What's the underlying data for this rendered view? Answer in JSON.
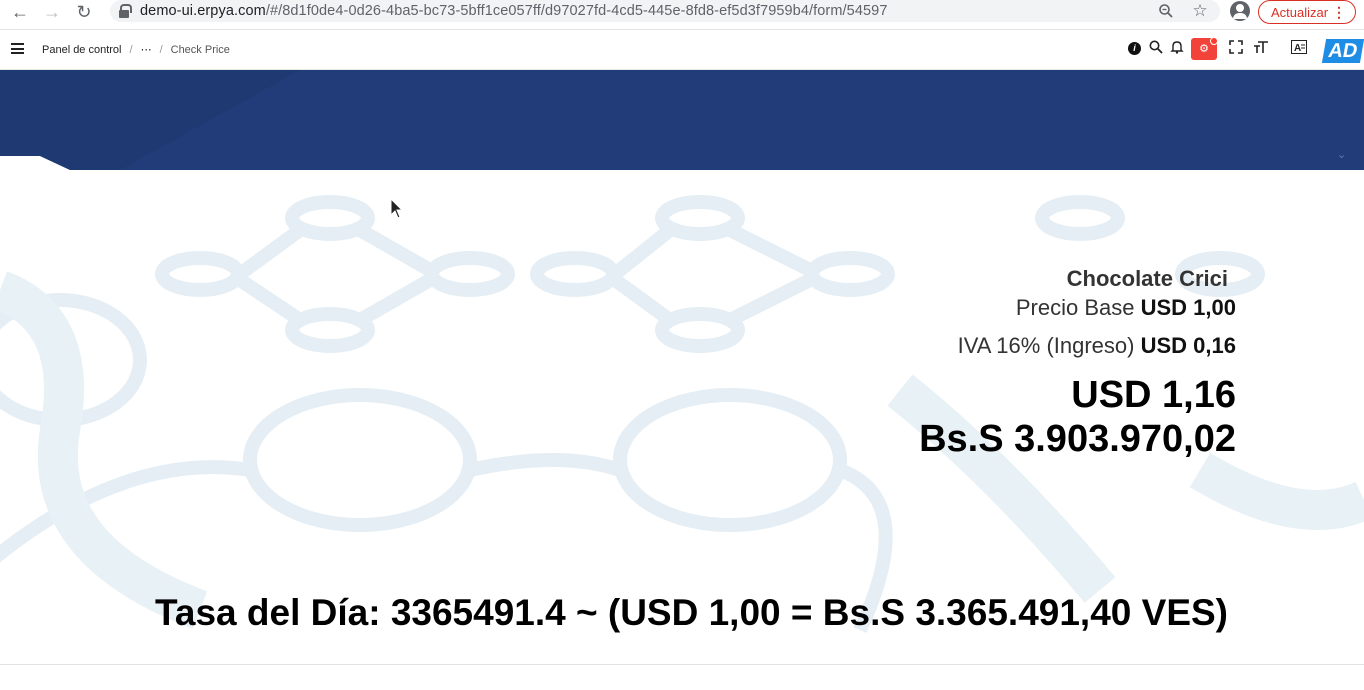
{
  "browser": {
    "url_host": "demo-ui.erpya.com",
    "url_path": "/#/8d1f0de4-0d26-4ba5-bc73-5bff1ce057ff/d97027fd-4cd5-445e-8fd8-ef5d3f7959b4/form/54597",
    "update_label": "Actualizar"
  },
  "header": {
    "breadcrumb": {
      "home": "Panel de control",
      "separator": "/",
      "ellipsis": "⋯",
      "current": "Check Price"
    },
    "avatar_initials": "AD"
  },
  "product": {
    "name": "Chocolate Crici",
    "base_price_label": "Precio Base",
    "base_price_value": "USD 1,00",
    "tax_label": "IVA 16% (Ingreso)",
    "tax_value": "USD 0,16",
    "total_usd": "USD 1,16",
    "total_ves": "Bs.S 3.903.970,02"
  },
  "exchange": {
    "rate_text": "Tasa del Día: 3365491.4 ~ (USD 1,00 = Bs.S 3.365.491,40 VES)"
  },
  "icons": {
    "back": "arrow-left",
    "forward": "arrow-right",
    "reload": "reload",
    "zoom": "magnifier",
    "bookmark": "star",
    "profile": "person-circle",
    "menu": "list-menu",
    "info": "info-circle",
    "search": "magnifier",
    "notifications": "bell",
    "bug": "bug",
    "fullscreen": "expand",
    "text_size": "font-size",
    "translate": "translate"
  },
  "colors": {
    "banner": "#203a74",
    "update_red": "#d93025",
    "badge_red": "#f2433b",
    "avatar_blue": "#1e8de5"
  }
}
